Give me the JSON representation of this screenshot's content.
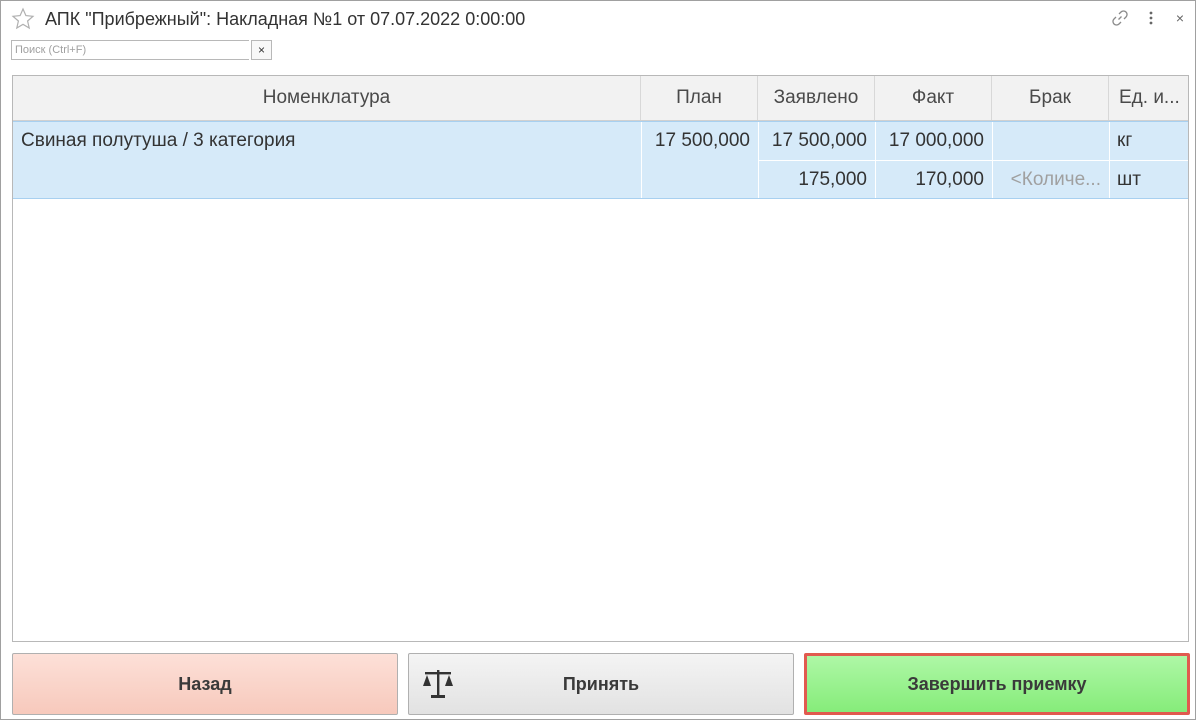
{
  "window": {
    "title": "АПК \"Прибрежный\": Накладная №1 от 07.07.2022 0:00:00",
    "icons": [
      "star-icon",
      "link-icon",
      "more-icon",
      "close-icon"
    ],
    "close_glyph": "×"
  },
  "search": {
    "value": "",
    "placeholder": "Поиск (Ctrl+F)",
    "clear_glyph": "×"
  },
  "table": {
    "columns": [
      "Номенклатура",
      "План",
      "Заявлено",
      "Факт",
      "Брак",
      "Ед. и..."
    ],
    "rows": [
      {
        "name": "Свиная полутуша / 3 категория",
        "plan": "17 500,000",
        "declared": "17 500,000",
        "fact": "17 000,000",
        "defect": "",
        "unit": "кг",
        "declared2": "175,000",
        "fact2": "170,000",
        "defect2_placeholder": "<Количе...",
        "unit2": "шт"
      }
    ]
  },
  "buttons": {
    "back": "Назад",
    "accept": "Принять",
    "accept_icon": "scale-icon",
    "finish": "Завершить приемку"
  },
  "colors": {
    "back": "#f7c9bc",
    "accept": "#e2e2e2",
    "finish": "#86ec7a",
    "finish_border": "#e15a4f",
    "row_selected": "#d6eaf9"
  }
}
